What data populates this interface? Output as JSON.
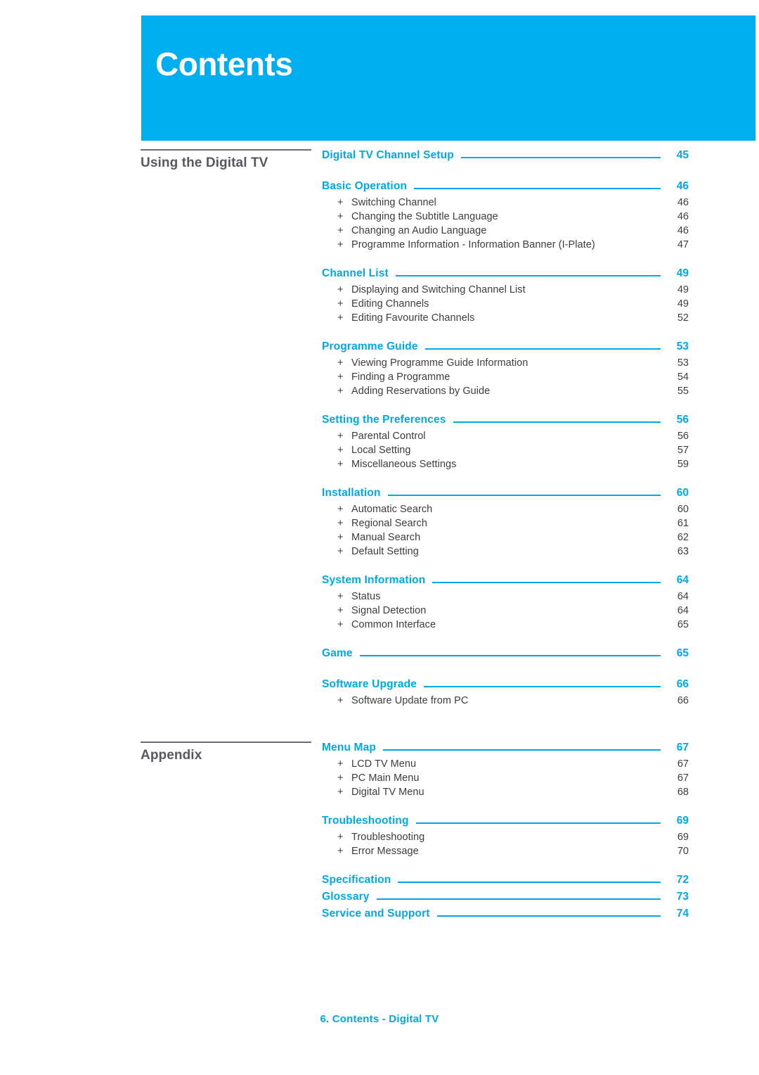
{
  "header": {
    "title": "Contents",
    "banner_color": "#00ADEE"
  },
  "colors": {
    "accent": "#00A8E8",
    "part_label": "#58585f",
    "body_text": "#3d3d3d",
    "rule": "#6b6b7b"
  },
  "bullet": "+",
  "parts": [
    {
      "label": "Using the Digital TV",
      "sections": [
        {
          "title": "Digital TV Channel Setup",
          "page": "45",
          "items": []
        },
        {
          "title": "Basic Operation",
          "page": "46",
          "items": [
            {
              "title": "Switching Channel",
              "page": "46"
            },
            {
              "title": "Changing the Subtitle Language",
              "page": "46"
            },
            {
              "title": "Changing an Audio Language",
              "page": "46"
            },
            {
              "title": "Programme Information - Information Banner (I-Plate)",
              "page": "47"
            }
          ]
        },
        {
          "title": "Channel List",
          "page": "49",
          "items": [
            {
              "title": "Displaying and Switching Channel List",
              "page": "49"
            },
            {
              "title": "Editing Channels",
              "page": "49"
            },
            {
              "title": "Editing Favourite Channels",
              "page": "52"
            }
          ]
        },
        {
          "title": "Programme Guide",
          "page": "53",
          "items": [
            {
              "title": "Viewing Programme Guide Information",
              "page": "53"
            },
            {
              "title": "Finding a Programme",
              "page": "54"
            },
            {
              "title": "Adding Reservations by Guide",
              "page": "55"
            }
          ]
        },
        {
          "title": "Setting the Preferences",
          "page": "56",
          "items": [
            {
              "title": "Parental Control",
              "page": "56"
            },
            {
              "title": "Local Setting",
              "page": "57"
            },
            {
              "title": "Miscellaneous Settings",
              "page": "59"
            }
          ]
        },
        {
          "title": "Installation",
          "page": "60",
          "items": [
            {
              "title": "Automatic Search",
              "page": "60"
            },
            {
              "title": "Regional Search",
              "page": "61"
            },
            {
              "title": "Manual Search",
              "page": "62"
            },
            {
              "title": "Default Setting",
              "page": "63"
            }
          ]
        },
        {
          "title": "System Information",
          "page": "64",
          "items": [
            {
              "title": "Status",
              "page": "64"
            },
            {
              "title": "Signal Detection",
              "page": "64"
            },
            {
              "title": "Common Interface",
              "page": "65"
            }
          ]
        },
        {
          "title": "Game",
          "page": "65",
          "items": []
        },
        {
          "title": "Software Upgrade",
          "page": "66",
          "items": [
            {
              "title": "Software Update from PC",
              "page": "66"
            }
          ]
        }
      ]
    },
    {
      "label": "Appendix",
      "sections": [
        {
          "title": "Menu Map",
          "page": "67",
          "items": [
            {
              "title": "LCD TV Menu",
              "page": "67"
            },
            {
              "title": "PC Main Menu",
              "page": "67"
            },
            {
              "title": "Digital TV Menu",
              "page": "68"
            }
          ]
        },
        {
          "title": "Troubleshooting",
          "page": "69",
          "items": [
            {
              "title": "Troubleshooting",
              "page": "69"
            },
            {
              "title": "Error Message",
              "page": "70"
            }
          ]
        },
        {
          "title": "Specification",
          "page": "72",
          "items": []
        },
        {
          "title": "Glossary",
          "page": "73",
          "items": []
        },
        {
          "title": "Service and Support",
          "page": "74",
          "items": []
        }
      ]
    }
  ],
  "footer": {
    "text": "6. Contents - Digital TV"
  }
}
